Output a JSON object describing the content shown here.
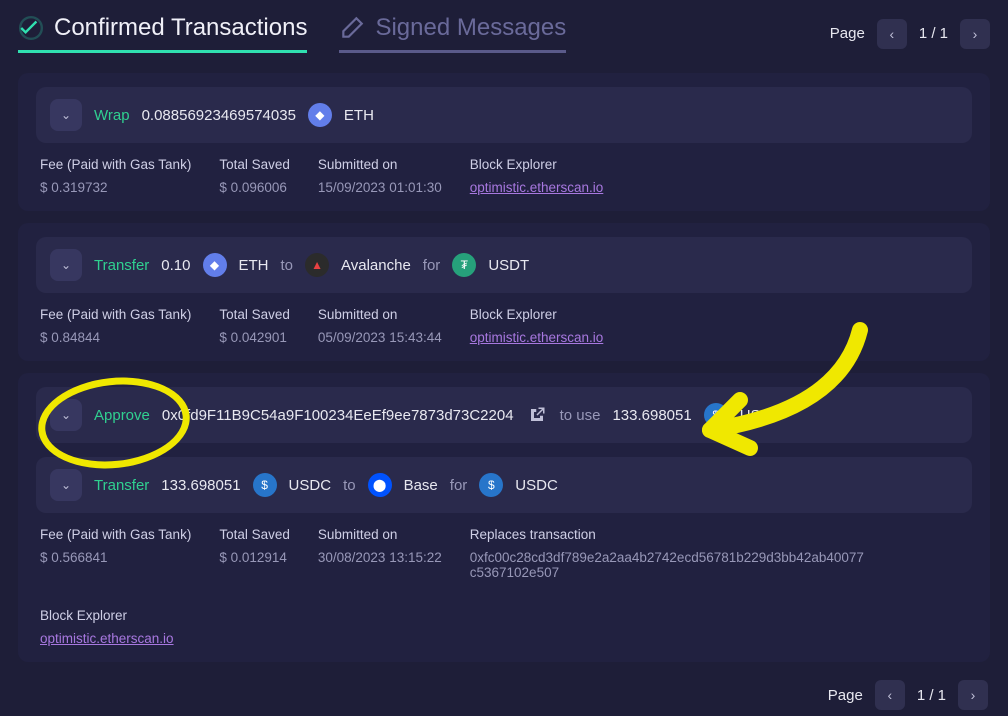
{
  "tabs": {
    "confirmed": "Confirmed Transactions",
    "signed": "Signed Messages"
  },
  "pager": {
    "label": "Page",
    "position": "1 / 1"
  },
  "labels": {
    "fee": "Fee (Paid with Gas Tank)",
    "saved": "Total Saved",
    "submitted": "Submitted on",
    "explorer": "Block Explorer",
    "replaces": "Replaces transaction",
    "to": "to",
    "for": "for",
    "to_use": "to use"
  },
  "explorer_link": "optimistic.etherscan.io",
  "tx": [
    {
      "rows": [
        {
          "action": "Wrap",
          "amount": "0.08856923469574035",
          "coin": "eth",
          "coin_sym": "◆",
          "symbol": "ETH"
        }
      ],
      "fee": "$ 0.319732",
      "saved": "$ 0.096006",
      "submitted": "15/09/2023 01:01:30"
    },
    {
      "rows": [
        {
          "action": "Transfer",
          "amount": "0.10",
          "coin": "eth",
          "coin_sym": "◆",
          "symbol": "ETH",
          "to_coin": "avax",
          "to_coin_sym": "▲",
          "to_name": "Avalanche",
          "for_coin": "usdt",
          "for_coin_sym": "₮",
          "for_symbol": "USDT"
        }
      ],
      "fee": "$ 0.84844",
      "saved": "$ 0.042901",
      "submitted": "05/09/2023 15:43:44"
    },
    {
      "rows": [
        {
          "action": "Approve",
          "address": "0x0fd9F11B9C54a9F100234EeEf9ee7873d73C2204",
          "ext": true,
          "to_use_amount": "133.698051",
          "to_use_coin": "usdc",
          "to_use_coin_sym": "$",
          "to_use_symbol": "USDC"
        },
        {
          "action": "Transfer",
          "amount": "133.698051",
          "coin": "usdc",
          "coin_sym": "$",
          "symbol": "USDC",
          "to_coin": "base",
          "to_coin_sym": "⬤",
          "to_name": "Base",
          "for_coin": "usdc",
          "for_coin_sym": "$",
          "for_symbol": "USDC"
        }
      ],
      "fee": "$ 0.566841",
      "saved": "$ 0.012914",
      "submitted": "30/08/2023 13:15:22",
      "replaces": "0xfc00c28cd3df789e2a2aa4b2742ecd56781b229d3bb42ab40077c5367102e507"
    }
  ]
}
